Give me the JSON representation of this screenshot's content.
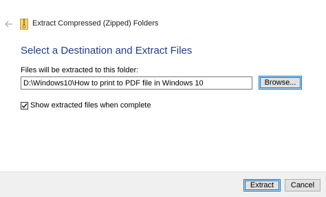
{
  "header": {
    "back_icon": "back-arrow-icon",
    "app_icon": "zip-folder-icon",
    "title": "Extract Compressed (Zipped) Folders"
  },
  "main": {
    "heading": "Select a Destination and Extract Files",
    "path_label": "Files will be extracted to this folder:",
    "path_value": "D:\\Windows10\\How to print to PDF file in Windows 10",
    "browse_label": "Browse...",
    "show_files_label": "Show extracted files when complete",
    "show_files_checked": true
  },
  "footer": {
    "extract_label": "Extract",
    "cancel_label": "Cancel"
  },
  "colors": {
    "heading": "#1e3d8f",
    "focus_border": "#0078d7",
    "footer_bg": "#f0f0f0"
  }
}
